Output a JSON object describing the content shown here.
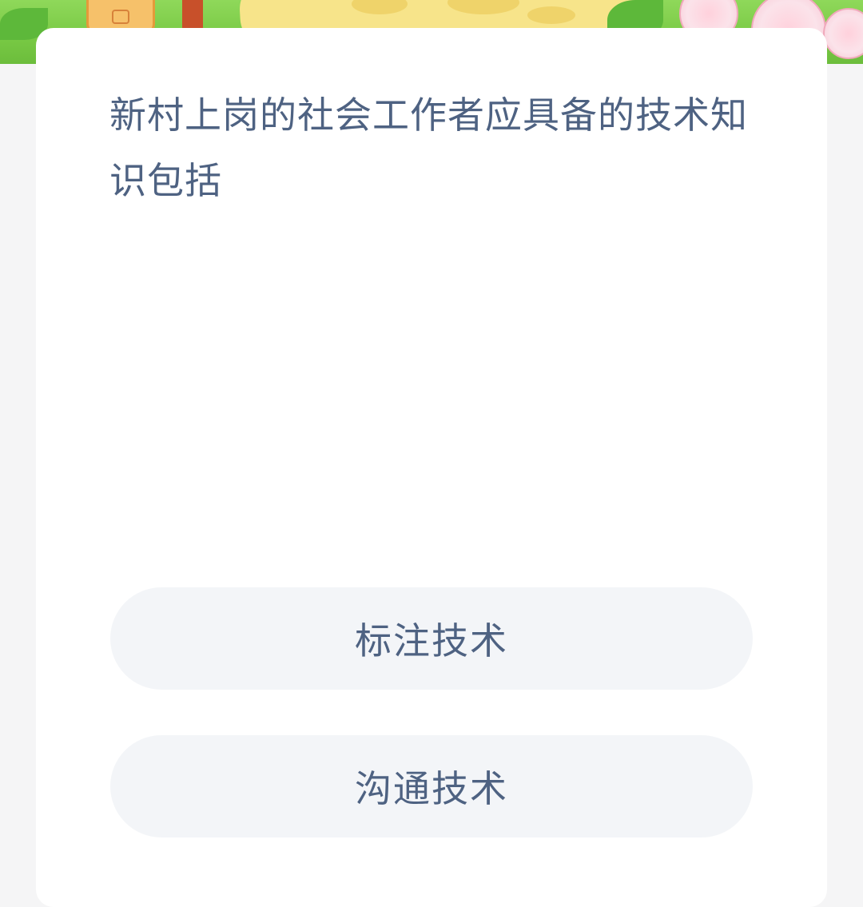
{
  "question": {
    "text": "新村上岗的社会工作者应具备的技术知识包括"
  },
  "options": [
    {
      "label": "标注技术"
    },
    {
      "label": "沟通技术"
    }
  ],
  "colors": {
    "page_background": "#f5f5f6",
    "card_background": "#ffffff",
    "text": "#4e6282",
    "option_background": "#f3f5f8",
    "banner_green": "#78c944"
  }
}
